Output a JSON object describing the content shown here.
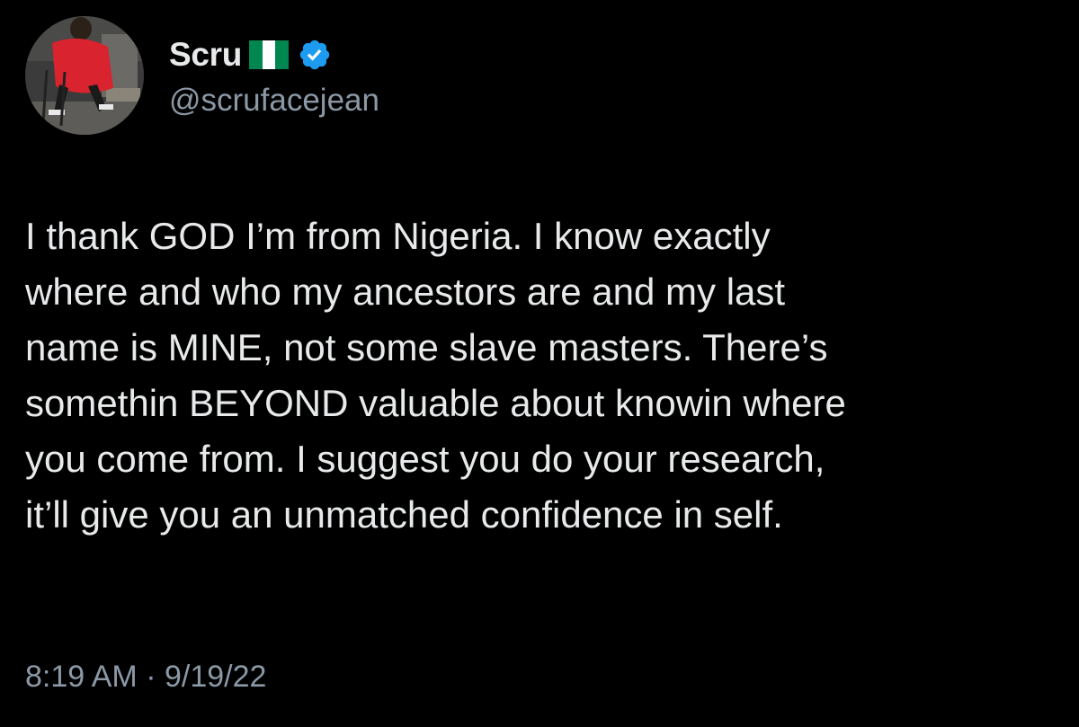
{
  "author": {
    "display_name": "Scru",
    "flag_icon": "nigeria-flag-icon",
    "flag_colors": [
      "#008751",
      "#ffffff",
      "#008751"
    ],
    "verified_icon": "verified-badge-icon",
    "verified_color": "#1d9bf0",
    "handle": "@scrufacejean",
    "avatar_icon": "profile-photo"
  },
  "tweet": {
    "text": "I thank GOD I’m from Nigeria. I know exactly\nwhere and who my ancestors are and my last\nname is MINE, not some slave masters. There’s\nsomethin BEYOND valuable about knowin where\nyou come from. I suggest you do your research,\nit’ll give you an unmatched confidence in self.",
    "timestamp": "8:19 AM · 9/19/22"
  },
  "colors": {
    "background": "#000000",
    "primary_text": "#e7e9ea",
    "secondary_text": "#8b98a5"
  }
}
